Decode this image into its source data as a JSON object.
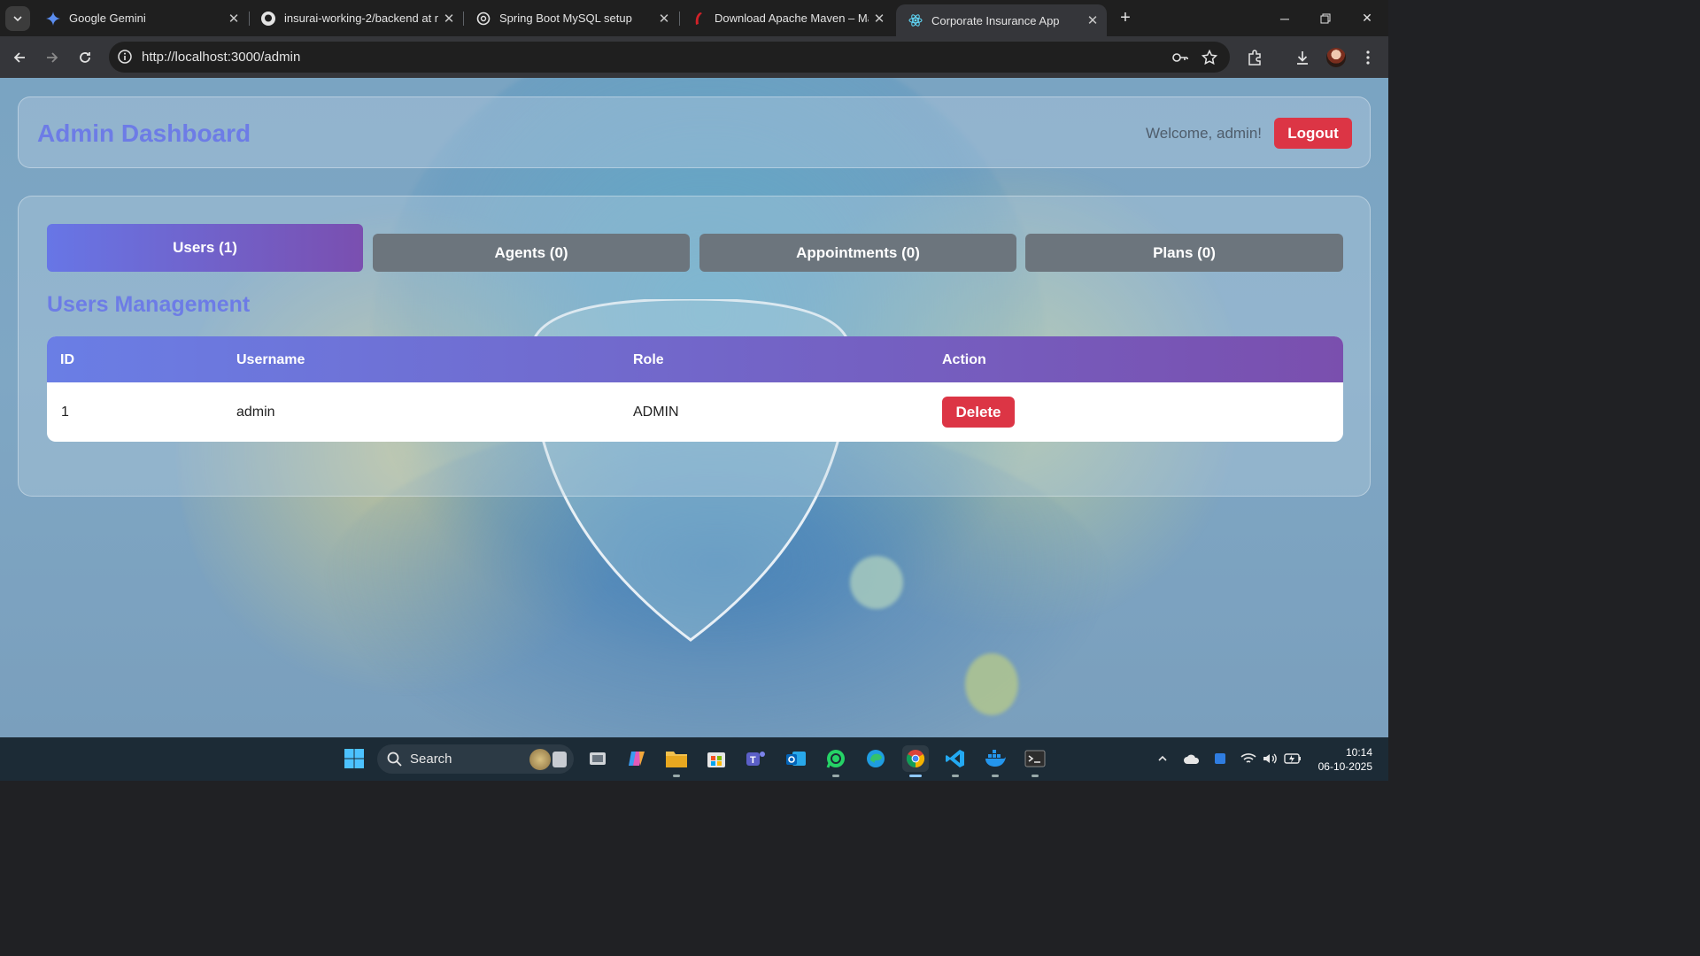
{
  "browser": {
    "tabs": [
      {
        "title": "Google Gemini",
        "icon": "gemini-icon",
        "active": false
      },
      {
        "title": "insurai-working-2/backend at m",
        "icon": "github-icon",
        "active": false
      },
      {
        "title": "Spring Boot MySQL setup",
        "icon": "chatgpt-icon",
        "active": false
      },
      {
        "title": "Download Apache Maven – Ma",
        "icon": "maven-icon",
        "active": false
      },
      {
        "title": "Corporate Insurance App",
        "icon": "react-icon",
        "active": true
      }
    ],
    "url": "http://localhost:3000/admin"
  },
  "app": {
    "title": "Admin Dashboard",
    "welcome": "Welcome, admin!",
    "logout_label": "Logout",
    "tabs": [
      {
        "label": "Users (1)",
        "active": true
      },
      {
        "label": "Agents (0)",
        "active": false
      },
      {
        "label": "Appointments (0)",
        "active": false
      },
      {
        "label": "Plans (0)",
        "active": false
      }
    ],
    "section_title": "Users Management",
    "table": {
      "headers": [
        "ID",
        "Username",
        "Role",
        "Action"
      ],
      "rows": [
        {
          "id": "1",
          "username": "admin",
          "role": "ADMIN",
          "action": "Delete"
        }
      ]
    },
    "colors": {
      "accent": "#6d7ce6",
      "danger": "#dc3545",
      "inactive_tab": "#6c757d"
    }
  },
  "taskbar": {
    "search_label": "Search",
    "time": "10:14",
    "date": "06-10-2025"
  }
}
